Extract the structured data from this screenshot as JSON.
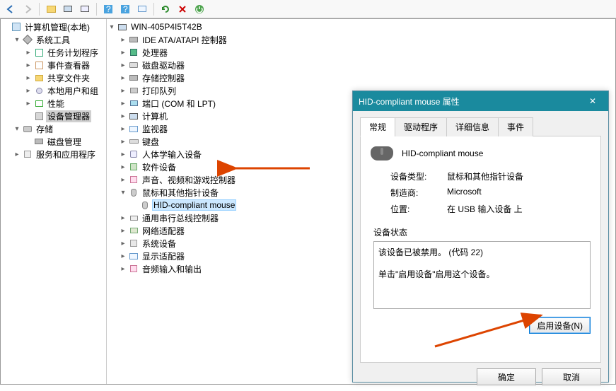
{
  "toolbar": {
    "buttons": [
      "back",
      "forward",
      "open",
      "props",
      "console",
      "help1",
      "help2",
      "monitor",
      "refresh",
      "delete",
      "enable"
    ]
  },
  "left_tree": {
    "root": "计算机管理(本地)",
    "groups": [
      {
        "label": "系统工具",
        "children": [
          {
            "label": "任务计划程序"
          },
          {
            "label": "事件查看器"
          },
          {
            "label": "共享文件夹"
          },
          {
            "label": "本地用户和组"
          },
          {
            "label": "性能"
          },
          {
            "label": "设备管理器",
            "selected": true
          }
        ]
      },
      {
        "label": "存储",
        "children": [
          {
            "label": "磁盘管理"
          }
        ]
      },
      {
        "label": "服务和应用程序"
      }
    ]
  },
  "right_tree": {
    "root": "WIN-405P4I5T42B",
    "items": [
      {
        "label": "IDE ATA/ATAPI 控制器"
      },
      {
        "label": "处理器"
      },
      {
        "label": "磁盘驱动器"
      },
      {
        "label": "存储控制器"
      },
      {
        "label": "打印队列"
      },
      {
        "label": "端口 (COM 和 LPT)"
      },
      {
        "label": "计算机"
      },
      {
        "label": "监视器"
      },
      {
        "label": "键盘"
      },
      {
        "label": "人体学输入设备"
      },
      {
        "label": "软件设备"
      },
      {
        "label": "声音、视频和游戏控制器"
      },
      {
        "label": "鼠标和其他指针设备",
        "expanded": true,
        "children": [
          {
            "label": "HID-compliant mouse",
            "hi": true
          }
        ]
      },
      {
        "label": "通用串行总线控制器"
      },
      {
        "label": "网络适配器"
      },
      {
        "label": "系统设备"
      },
      {
        "label": "显示适配器"
      },
      {
        "label": "音频输入和输出"
      }
    ]
  },
  "dialog": {
    "title": "HID-compliant mouse 属性",
    "tabs": [
      "常规",
      "驱动程序",
      "详细信息",
      "事件"
    ],
    "device_name": "HID-compliant mouse",
    "rows": {
      "type_k": "设备类型:",
      "type_v": "鼠标和其他指针设备",
      "vendor_k": "制造商:",
      "vendor_v": "Microsoft",
      "loc_k": "位置:",
      "loc_v": "在 USB 输入设备 上"
    },
    "status_label": "设备状态",
    "status_text": "该设备已被禁用。 (代码 22)\n\n单击\"启用设备\"启用这个设备。",
    "enable_btn": "启用设备(N)",
    "ok": "确定",
    "cancel": "取消"
  }
}
